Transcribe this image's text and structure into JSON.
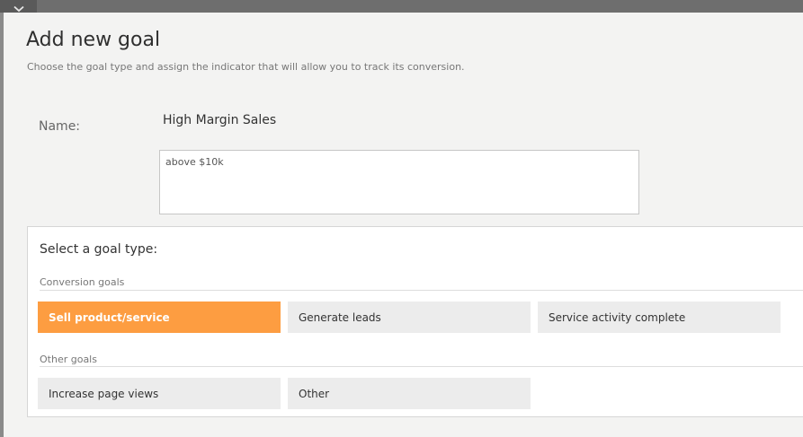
{
  "header": {
    "collapse_icon": "chevron-down-icon"
  },
  "dialog": {
    "title": "Add new goal",
    "subtitle": "Choose the goal type and assign the indicator that will allow you to track its conversion.",
    "name_label": "Name:",
    "name_value": "High Margin Sales",
    "description_value": "above $10k"
  },
  "goal_type": {
    "heading": "Select a goal type:",
    "sections": [
      {
        "label": "Conversion goals",
        "options": [
          {
            "label": "Sell product/service",
            "selected": true
          },
          {
            "label": "Generate leads",
            "selected": false
          },
          {
            "label": "Service activity complete",
            "selected": false
          }
        ]
      },
      {
        "label": "Other goals",
        "options": [
          {
            "label": "Increase page views",
            "selected": false
          },
          {
            "label": "Other",
            "selected": false
          }
        ]
      }
    ]
  },
  "colors": {
    "selected_accent": "#fd9d41",
    "option_bg": "#ececec",
    "panel_bg": "#f3f3f2"
  }
}
